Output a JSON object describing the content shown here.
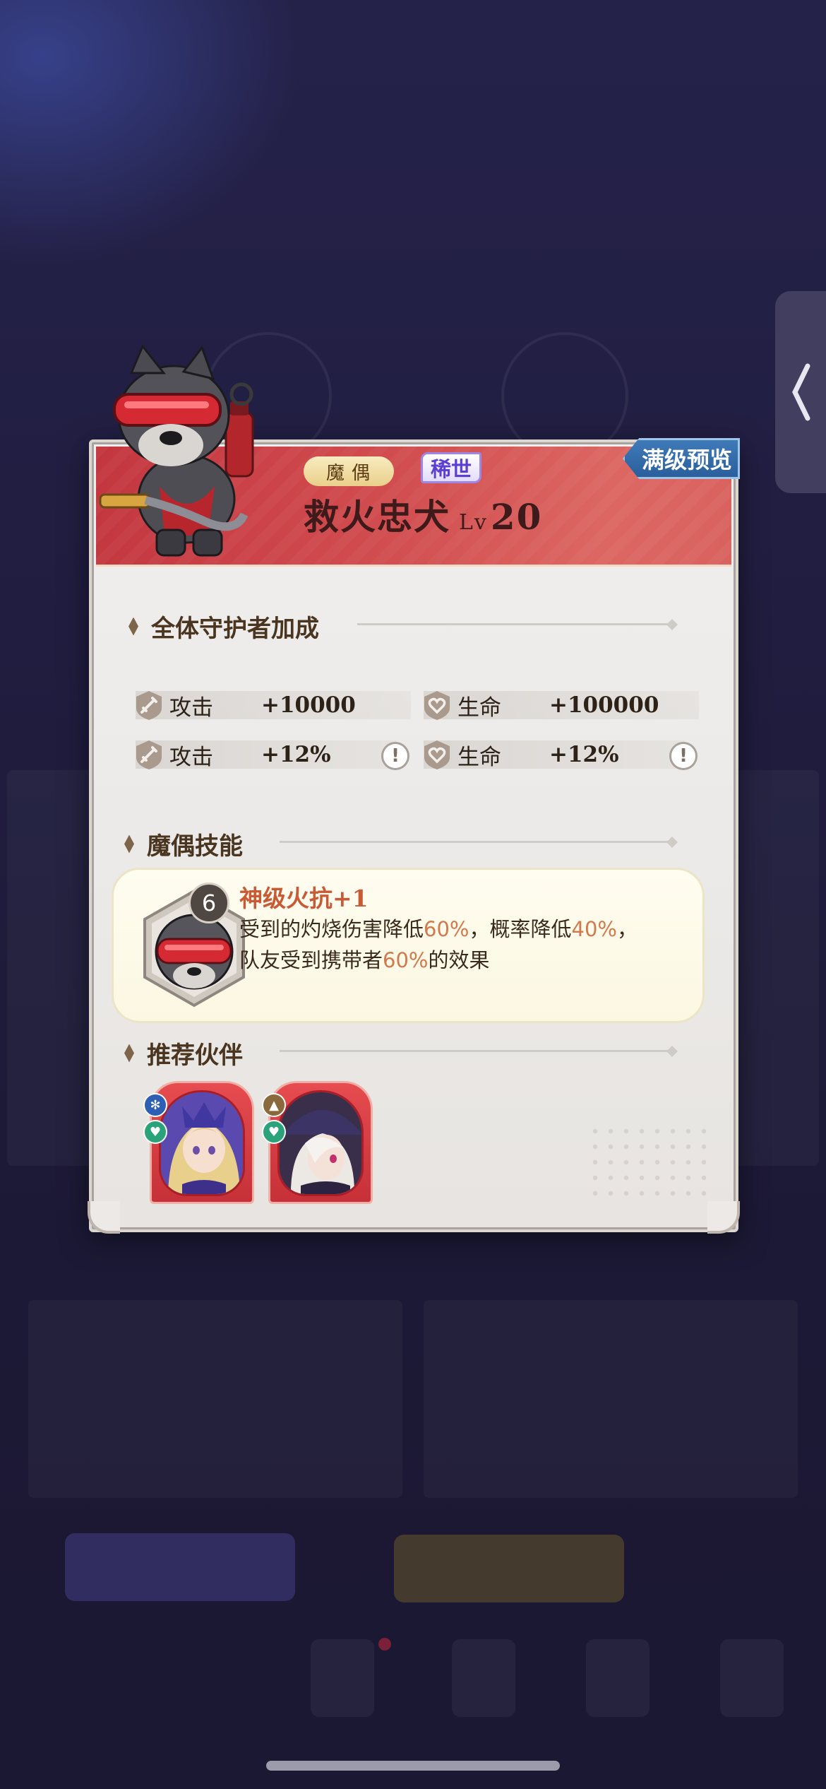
{
  "colors": {
    "header_red": "#d14c4f",
    "skill_highlight": "#d07a4e",
    "skill_name": "#c85a36",
    "preview_tag_blue": "#2a5f9c",
    "rarity_purple": "#5a3fd0"
  },
  "pet": {
    "type_badge": "魔偶",
    "rarity": "稀世",
    "name": "救火忠犬",
    "level_prefix": "Lv",
    "level": "20",
    "preview_label": "满级预览"
  },
  "guardian_bonus": {
    "title": "全体守护者加成",
    "stats": [
      {
        "icon": "sword-shield-icon",
        "label": "攻击",
        "value": "+10000",
        "info": false
      },
      {
        "icon": "heart-shield-icon",
        "label": "生命",
        "value": "+100000",
        "info": false
      },
      {
        "icon": "sword-shield-icon",
        "label": "攻击",
        "value": "+12%",
        "info": true
      },
      {
        "icon": "heart-shield-icon",
        "label": "生命",
        "value": "+12%",
        "info": true
      }
    ],
    "info_glyph": "!"
  },
  "skills": {
    "title": "魔偶技能",
    "items": [
      {
        "count": "6",
        "name": "神级火抗+1",
        "desc_parts": [
          "受到的灼烧伤害降低",
          "60%",
          "，概率降低",
          "40%",
          "，",
          "队友受到携带者",
          "60%",
          "的效果"
        ]
      }
    ]
  },
  "partners": {
    "title": "推荐伙伴",
    "items": [
      {
        "element_icon": "snowflake-icon",
        "role_icon": "heart-role-icon",
        "portrait": "blonde-girl-portrait"
      },
      {
        "element_icon": "earth-icon",
        "role_icon": "heart-role-icon",
        "portrait": "white-hair-witch-portrait"
      }
    ]
  },
  "side_tab": {
    "icon": "chevron-left-icon"
  }
}
